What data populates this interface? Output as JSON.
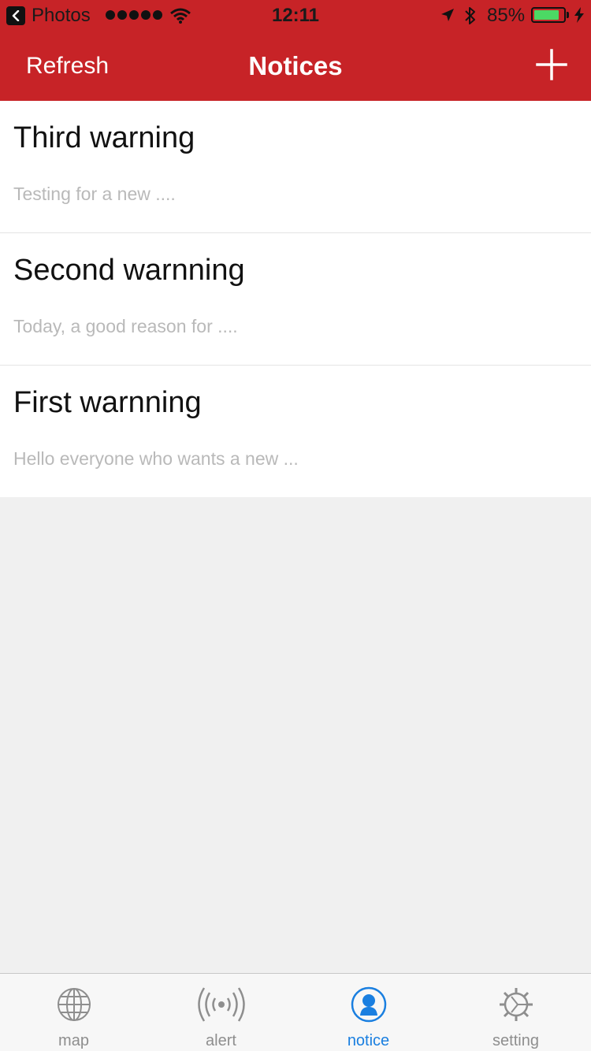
{
  "status_bar": {
    "back_app": "Photos",
    "time": "12:11",
    "battery_percent": "85%",
    "battery_level": 0.85,
    "icons": [
      "back-arrow-icon",
      "signal-dots-icon",
      "wifi-icon",
      "location-arrow-icon",
      "bluetooth-icon",
      "battery-icon",
      "charging-bolt-icon"
    ]
  },
  "nav": {
    "refresh_label": "Refresh",
    "title": "Notices",
    "add_icon": "plus-icon"
  },
  "notices": [
    {
      "title": "Third warning",
      "preview": "Testing for a new ...."
    },
    {
      "title": "Second warnning",
      "preview": "Today, a good reason for ...."
    },
    {
      "title": "First warnning",
      "preview": "Hello everyone who wants a new  ..."
    }
  ],
  "tabs": [
    {
      "label": "map",
      "icon": "globe-icon",
      "active": false
    },
    {
      "label": "alert",
      "icon": "broadcast-icon",
      "active": false
    },
    {
      "label": "notice",
      "icon": "person-icon",
      "active": true
    },
    {
      "label": "setting",
      "icon": "gear-icon",
      "active": false
    }
  ],
  "colors": {
    "header": "#c72327",
    "active_tab": "#1a7fe0",
    "inactive_tab": "#8e8e8e",
    "preview_text": "#b9b9b9",
    "background": "#f0f0f0",
    "battery_fill": "#4cd964"
  }
}
